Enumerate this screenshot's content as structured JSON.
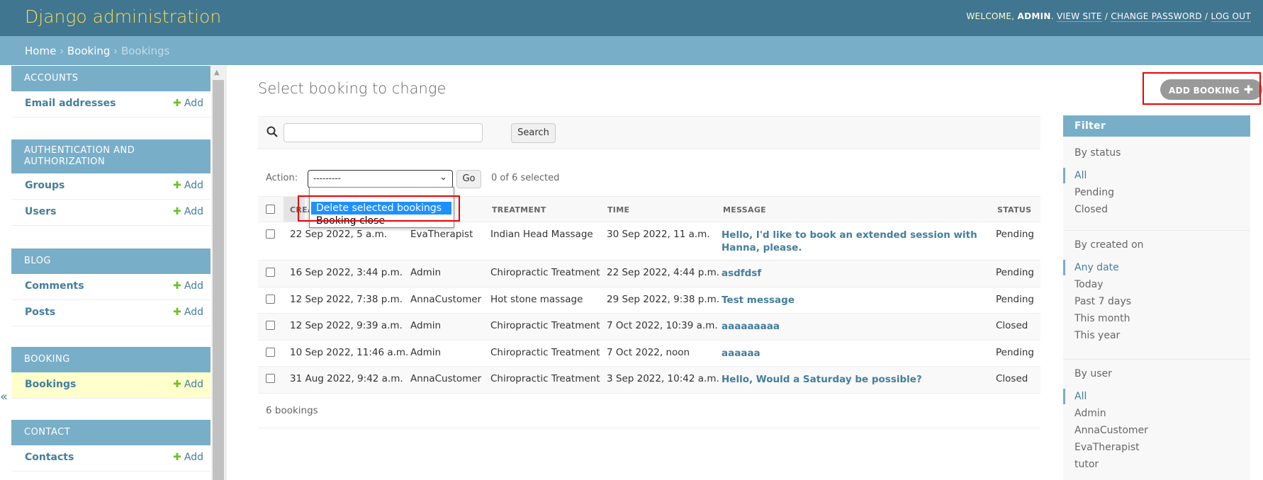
{
  "header": {
    "branding": "Django administration",
    "welcome": "Welcome,",
    "user": "admin",
    "view_site": "View site",
    "change_password": "Change password",
    "log_out": "Log out"
  },
  "breadcrumbs": {
    "home": "Home",
    "app": "Booking",
    "current": "Bookings",
    "sep": "›"
  },
  "sidebar": {
    "add_label": "Add",
    "modules": [
      {
        "caption": "Accounts",
        "models": [
          "Email addresses"
        ]
      },
      {
        "caption": "Authentication and Authorization",
        "models": [
          "Groups",
          "Users"
        ]
      },
      {
        "caption": "Blog",
        "models": [
          "Comments",
          "Posts"
        ]
      },
      {
        "caption": "Booking",
        "models": [
          "Bookings"
        ]
      },
      {
        "caption": "Contact",
        "models": [
          "Contacts"
        ]
      }
    ],
    "toggle": "«"
  },
  "content": {
    "title": "Select booking to change",
    "add_button": "Add booking",
    "search_button": "Search",
    "action_label": "Action:",
    "action_selected": "---------",
    "go_button": "Go",
    "selected_count": "0 of 6 selected",
    "paginator": "6 bookings"
  },
  "action_dropdown": {
    "options": [
      "Delete selected bookings",
      "Booking close"
    ]
  },
  "table": {
    "columns": [
      "Created on",
      "User",
      "Treatment",
      "Time",
      "Message",
      "Status"
    ],
    "visible_first_col": "CREA",
    "rows": [
      {
        "created": "22 Sep 2022, 5 a.m.",
        "user": "EvaTherapist",
        "treatment": "Indian Head Massage",
        "time": "30 Sep 2022, 11 a.m.",
        "message": "Hello, I'd like to book an extended session with Hanna, please.",
        "status": "Pending"
      },
      {
        "created": "16 Sep 2022, 3:44 p.m.",
        "user": "Admin",
        "treatment": "Chiropractic Treatment",
        "time": "22 Sep 2022, 4:44 p.m.",
        "message": "asdfdsf",
        "status": "Pending"
      },
      {
        "created": "12 Sep 2022, 7:38 p.m.",
        "user": "AnnaCustomer",
        "treatment": "Hot stone massage",
        "time": "29 Sep 2022, 9:38 p.m.",
        "message": "Test message",
        "status": "Pending"
      },
      {
        "created": "12 Sep 2022, 9:39 a.m.",
        "user": "Admin",
        "treatment": "Chiropractic Treatment",
        "time": "7 Oct 2022, 10:39 a.m.",
        "message": "aaaaaaaaa",
        "status": "Closed"
      },
      {
        "created": "10 Sep 2022, 11:46 a.m.",
        "user": "Admin",
        "treatment": "Chiropractic Treatment",
        "time": "7 Oct 2022, noon",
        "message": "aaaaaa",
        "status": "Pending"
      },
      {
        "created": "31 Aug 2022, 9:42 a.m.",
        "user": "AnnaCustomer",
        "treatment": "Chiropractic Treatment",
        "time": "3 Sep 2022, 10:42 a.m.",
        "message": "Hello, Would a Saturday be possible?",
        "status": "Closed"
      }
    ]
  },
  "filter": {
    "title": "Filter",
    "sections": [
      {
        "heading": "By status",
        "items": [
          "All",
          "Pending",
          "Closed"
        ]
      },
      {
        "heading": "By created on",
        "items": [
          "Any date",
          "Today",
          "Past 7 days",
          "This month",
          "This year"
        ]
      },
      {
        "heading": "By user",
        "items": [
          "All",
          "Admin",
          "AnnaCustomer",
          "EvaTherapist",
          "tutor"
        ]
      }
    ]
  },
  "colors": {
    "header_bg": "#417690",
    "branding": "#f5dd5d",
    "module_caption_bg": "#79aec8",
    "link": "#447e9b",
    "add_plus": "#70bf2b",
    "highlight_box": "#e00000",
    "dropdown_selected": "#1e90ff"
  }
}
